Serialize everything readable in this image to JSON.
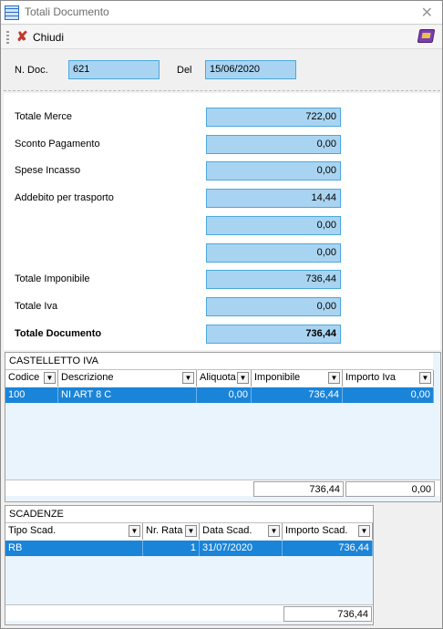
{
  "window": {
    "title": "Totali Documento",
    "close_icon": "close-icon"
  },
  "toolbar": {
    "close_label": "Chiudi",
    "close_icon": "x-icon",
    "right_icon": "book-icon"
  },
  "header": {
    "doc_label": "N. Doc.",
    "doc_value": "621",
    "date_label": "Del",
    "date_value": "15/06/2020"
  },
  "totals": {
    "merce_label": "Totale Merce",
    "merce_value": "722,00",
    "sconto_label": "Sconto Pagamento",
    "sconto_value": "0,00",
    "incasso_label": "Spese Incasso",
    "incasso_value": "0,00",
    "trasporto_label": "Addebito per trasporto",
    "trasporto_value": "14,44",
    "extra1_value": "0,00",
    "extra2_value": "0,00",
    "imponibile_label": "Totale Imponibile",
    "imponibile_value": "736,44",
    "iva_label": "Totale Iva",
    "iva_value": "0,00",
    "documento_label": "Totale Documento",
    "documento_value": "736,44"
  },
  "castelletto": {
    "title": "CASTELLETTO IVA",
    "columns": [
      "Codice",
      "Descrizione",
      "Aliquota",
      "Imponibile",
      "Importo Iva"
    ],
    "rows": [
      {
        "codice": "100",
        "descrizione": "NI ART 8 C",
        "aliquota": "0,00",
        "imponibile": "736,44",
        "importo_iva": "0,00"
      }
    ],
    "footer_imponibile": "736,44",
    "footer_iva": "0,00"
  },
  "scadenze": {
    "title": "SCADENZE",
    "columns": [
      "Tipo Scad.",
      "Nr. Rata",
      "Data Scad.",
      "Importo Scad."
    ],
    "rows": [
      {
        "tipo": "RB",
        "rata": "1",
        "data": "31/07/2020",
        "importo": "736,44"
      }
    ],
    "footer_importo": "736,44"
  },
  "colors": {
    "field_bg": "#a9d4f1",
    "field_border": "#4aa8dc",
    "selection": "#1a84d8",
    "grid_bg": "#eaf4fd"
  }
}
